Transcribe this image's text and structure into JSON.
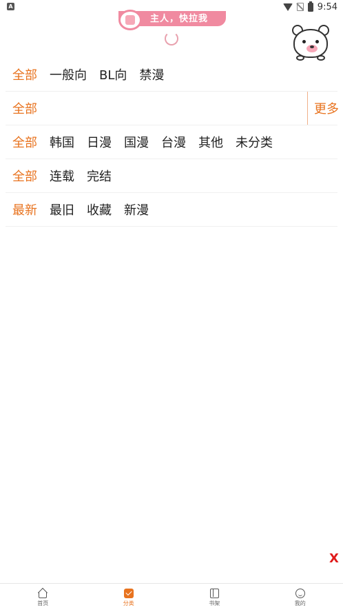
{
  "status_bar": {
    "time": "9:54"
  },
  "banner": {
    "text": "主人，快拉我"
  },
  "filters": [
    {
      "all_label": "全部",
      "options": [
        "一般向",
        "BL向",
        "禁漫"
      ]
    },
    {
      "all_label": "全部",
      "options": [],
      "more_label": "更多"
    },
    {
      "all_label": "全部",
      "options": [
        "韩国",
        "日漫",
        "国漫",
        "台漫",
        "其他",
        "未分类"
      ]
    },
    {
      "all_label": "全部",
      "options": [
        "连载",
        "完结"
      ]
    },
    {
      "all_label": "最新",
      "options": [
        "最旧",
        "收藏",
        "新漫"
      ]
    }
  ],
  "close_label": "X",
  "tabbar": {
    "tabs": [
      {
        "label": "首页",
        "icon": "home-icon"
      },
      {
        "label": "分类",
        "icon": "category-cube-icon"
      },
      {
        "label": "书架",
        "icon": "bookshelf-icon"
      },
      {
        "label": "我的",
        "icon": "profile-icon"
      }
    ],
    "active_index": 1
  },
  "colors": {
    "accent": "#e8731f",
    "banner": "#f08aa0",
    "close": "#e01b1b"
  }
}
